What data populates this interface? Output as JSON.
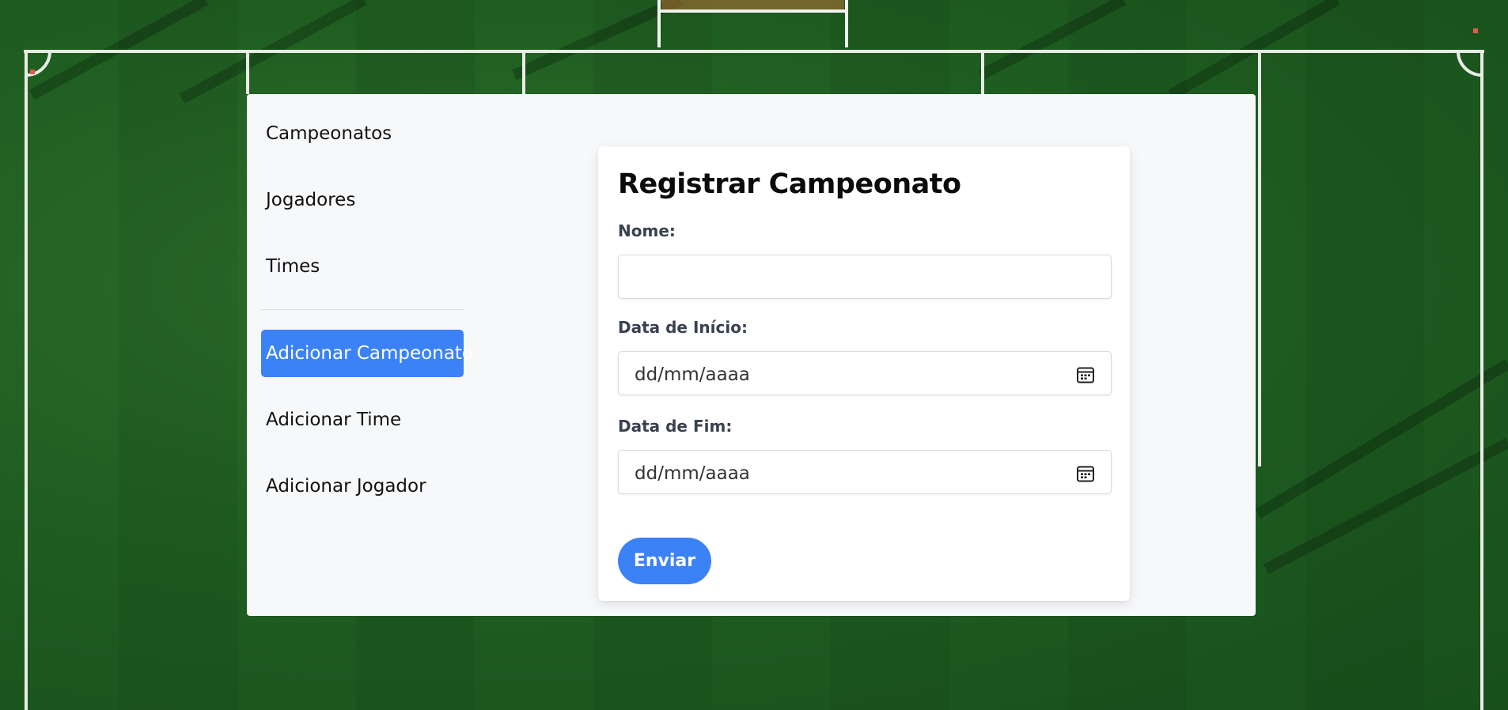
{
  "sidebar": {
    "items": [
      {
        "label": "Campeonatos"
      },
      {
        "label": "Jogadores"
      },
      {
        "label": "Times"
      }
    ],
    "actions": [
      {
        "label": "Adicionar Campeonato",
        "active": true
      },
      {
        "label": "Adicionar Time"
      },
      {
        "label": "Adicionar Jogador"
      }
    ]
  },
  "form": {
    "title": "Registrar Campeonato",
    "name_label": "Nome:",
    "name_value": "",
    "start_label": "Data de Início:",
    "start_placeholder": "dd/mm/aaaa",
    "end_label": "Data de Fim:",
    "end_placeholder": "dd/mm/aaaa",
    "submit_label": "Enviar"
  },
  "colors": {
    "accent": "#3b82f6",
    "panel_bg": "#f7f8fa",
    "pitch_green": "#1f5e21"
  },
  "icons": {
    "date_picker": "calendar-icon"
  }
}
